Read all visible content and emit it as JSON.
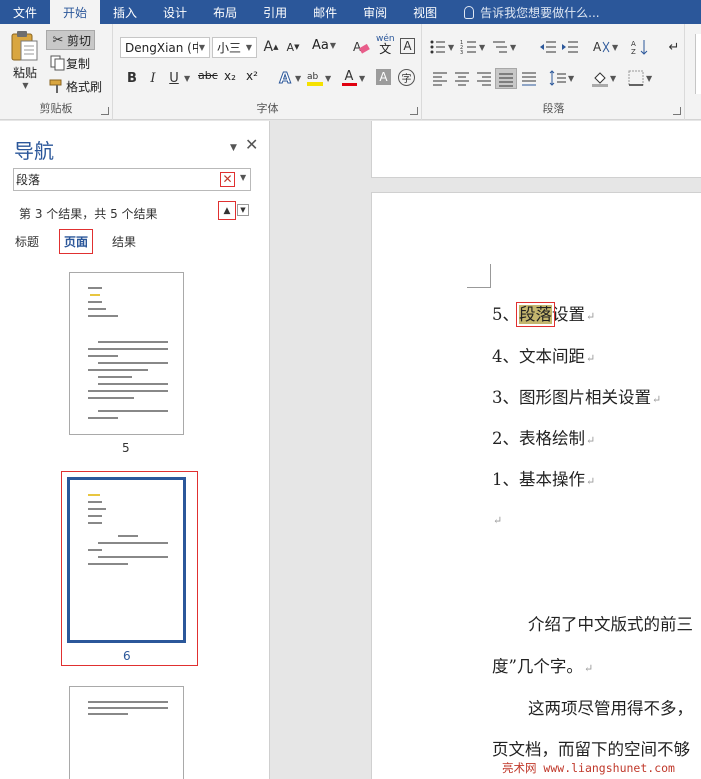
{
  "tabs": [
    "文件",
    "开始",
    "插入",
    "设计",
    "布局",
    "引用",
    "邮件",
    "审阅",
    "视图"
  ],
  "active_tab": "开始",
  "tell_me": "告诉我您想要做什么...",
  "clipboard": {
    "paste": "粘贴",
    "cut": "剪切",
    "copy": "复制",
    "format_painter": "格式刷",
    "label": "剪贴板"
  },
  "font": {
    "name": "DengXian (中",
    "size": "小三",
    "label": "字体",
    "grow": "A",
    "shrink": "A",
    "aa": "Aa",
    "bold": "B",
    "italic": "I",
    "underline": "U",
    "strike": "abc",
    "sub": "x₂",
    "sup": "x²",
    "phonetic": "wén",
    "phonetic_glyph": "文",
    "font_color_glyph": "A",
    "char_border_glyph": "A",
    "enclose_glyph": "字"
  },
  "paragraph": {
    "label": "段落"
  },
  "nav": {
    "title": "导航",
    "search_value": "段落",
    "result_count": "第 3 个结果，共 5 个结果",
    "tabs": {
      "headings": "标题",
      "pages": "页面",
      "results": "结果"
    },
    "page_numbers": [
      "5",
      "6"
    ]
  },
  "doc": {
    "lines": [
      "5、",
      "段落",
      "设置",
      "4、文本间距",
      "3、图形图片相关设置",
      "2、表格绘制",
      "1、基本操作"
    ],
    "body": [
      "介绍了中文版式的前三",
      "度”几个字。",
      "这两项尽管用得不多，",
      "页文档，而留下的空间不够"
    ]
  },
  "watermark": "亮术网 www.liangshunet.com"
}
